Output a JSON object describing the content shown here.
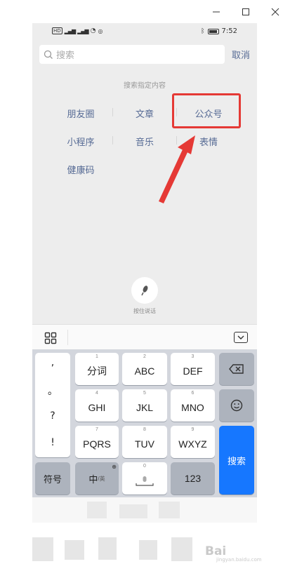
{
  "status_bar": {
    "hd_badge": "HD",
    "signal_1": "ᵃ⁴ᴳ",
    "signal_2": "ᵃ⁴ᴳ",
    "battery_text": "",
    "time": "7:52"
  },
  "search": {
    "placeholder": "搜索",
    "cancel_label": "取消"
  },
  "hint_text": "搜索指定内容",
  "categories": {
    "row1": [
      "朋友圈",
      "文章",
      "公众号"
    ],
    "row2": [
      "小程序",
      "音乐",
      "表情"
    ],
    "row3": [
      "健康码"
    ]
  },
  "voice": {
    "label": "按住说话"
  },
  "keyboard": {
    "punct": [
      ",",
      "。",
      "?",
      "!"
    ],
    "row1": [
      {
        "sub": "1",
        "label": "分词"
      },
      {
        "sub": "2",
        "label": "ABC"
      },
      {
        "sub": "3",
        "label": "DEF"
      }
    ],
    "row2": [
      {
        "sub": "4",
        "label": "GHI"
      },
      {
        "sub": "5",
        "label": "JKL"
      },
      {
        "sub": "6",
        "label": "MNO"
      }
    ],
    "row3": [
      {
        "sub": "7",
        "label": "PQRS"
      },
      {
        "sub": "8",
        "label": "TUV"
      },
      {
        "sub": "9",
        "label": "WXYZ"
      }
    ],
    "symbol_key": "符号",
    "lang_key_main": "中",
    "lang_key_alt": "/英",
    "space_sub": "0",
    "num_key": "123",
    "search_key": "搜索"
  },
  "watermark": {
    "text": "Bai",
    "sub": "jingyan.baidu.com"
  },
  "colors": {
    "link_blue": "#576b95",
    "highlight_red": "#e53935",
    "key_blue": "#1677ff"
  }
}
